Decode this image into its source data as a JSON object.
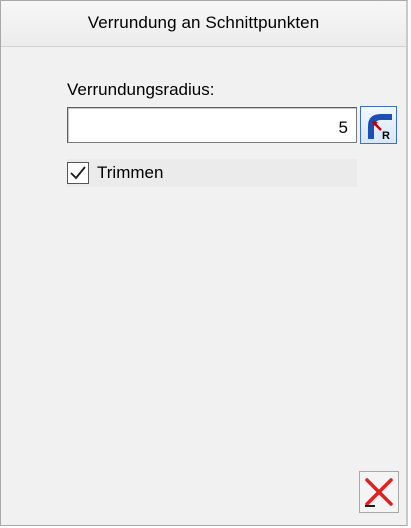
{
  "window": {
    "title": "Verrundung an Schnittpunkten"
  },
  "radius": {
    "label": "Verrundungsradius:",
    "value": "5",
    "button_icon": "fillet-radius-icon"
  },
  "trim": {
    "label": "Trimmen",
    "checked": true,
    "check_icon": "checkmark-icon"
  },
  "footer": {
    "cancel_icon": "close-icon"
  },
  "colors": {
    "panel_bg": "#f1f1f1",
    "accent_blue": "#1d4fb5",
    "cancel_red": "#e02020"
  }
}
